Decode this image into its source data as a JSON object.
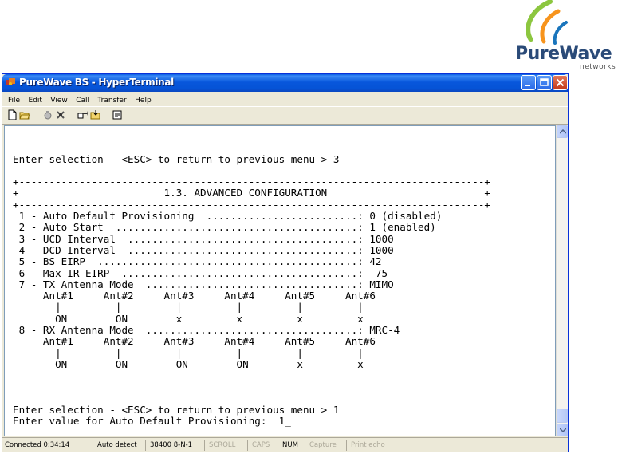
{
  "logo": {
    "name": "PureWave",
    "sub": "networks",
    "colors": [
      "#8cc63f",
      "#f7941d",
      "#1a75bc"
    ]
  },
  "window": {
    "title": "PureWave BS - HyperTerminal",
    "title_bar_color": "#0a5fe4"
  },
  "menu": [
    "File",
    "Edit",
    "View",
    "Call",
    "Transfer",
    "Help"
  ],
  "toolbar_icons": [
    "new-icon",
    "open-icon",
    "disconnect-icon",
    "connect-icon",
    "send-icon",
    "receive-icon",
    "properties-icon"
  ],
  "terminal": {
    "lines": [
      "",
      "",
      "Enter selection - <ESC> to return to previous menu > 3",
      "",
      "+-----------------------------------------------------------------------------+",
      "+                        1.3. ADVANCED CONFIGURATION                          +",
      "+-----------------------------------------------------------------------------+",
      " 1 - Auto Default Provisioning  .........................: 0 (disabled)",
      " 2 - Auto Start  ........................................: 1 (enabled)",
      " 3 - UCD Interval  ......................................: 1000",
      " 4 - DCD Interval  ......................................: 1000",
      " 5 - BS EIRP  ...........................................: 42",
      " 6 - Max IR EIRP  .......................................: -75",
      " 7 - TX Antenna Mode  ...................................: MIMO",
      "     Ant#1     Ant#2     Ant#3     Ant#4     Ant#5     Ant#6",
      "       |         |         |         |         |         |",
      "       ON        ON        x         x         x         x",
      " 8 - RX Antenna Mode  ...................................: MRC-4",
      "     Ant#1     Ant#2     Ant#3     Ant#4     Ant#5     Ant#6",
      "       |         |         |         |         |         |",
      "       ON        ON        ON        ON        x         x",
      "",
      "",
      "",
      "Enter selection - <ESC> to return to previous menu > 1",
      "Enter value for Auto Default Provisioning:  1_"
    ]
  },
  "status": {
    "connected": "Connected 0:34:14",
    "detect": "Auto detect",
    "baud": "38400 8-N-1",
    "scroll": "SCROLL",
    "caps": "CAPS",
    "num": "NUM",
    "capture": "Capture",
    "print": "Print echo"
  }
}
